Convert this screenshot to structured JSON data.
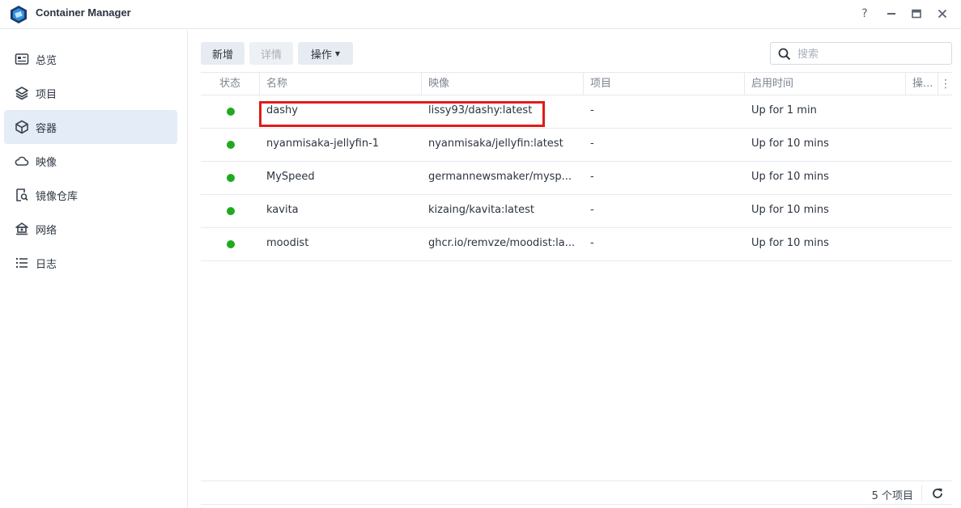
{
  "app": {
    "title": "Container Manager",
    "icon": "container-manager-logo",
    "window_controls": [
      "help-icon",
      "minimize-icon",
      "maximize-icon",
      "close-icon"
    ],
    "help_label": "?"
  },
  "sidebar": {
    "items": [
      {
        "label": "总览",
        "icon": "overview-icon",
        "active": false
      },
      {
        "label": "项目",
        "icon": "layers-icon",
        "active": false
      },
      {
        "label": "容器",
        "icon": "cube-icon",
        "active": true
      },
      {
        "label": "映像",
        "icon": "cloud-icon",
        "active": false
      },
      {
        "label": "镜像仓库",
        "icon": "registry-search-icon",
        "active": false
      },
      {
        "label": "网络",
        "icon": "network-icon",
        "active": false
      },
      {
        "label": "日志",
        "icon": "list-icon",
        "active": false
      }
    ]
  },
  "toolbar": {
    "new_label": "新增",
    "detail_label": "详情",
    "ops_label": "操作",
    "search_placeholder": "搜索"
  },
  "table": {
    "columns": [
      "状态",
      "名称",
      "映像",
      "项目",
      "启用时间",
      "操..."
    ],
    "rows": [
      {
        "status": "running",
        "name": "dashy",
        "image": "lissy93/dashy:latest",
        "project": "-",
        "uptime": "Up for 1 min"
      },
      {
        "status": "running",
        "name": "nyanmisaka-jellyfin-1",
        "image": "nyanmisaka/jellyfin:latest",
        "project": "-",
        "uptime": "Up for 10 mins"
      },
      {
        "status": "running",
        "name": "MySpeed",
        "image": "germannewsmaker/mysp...",
        "project": "-",
        "uptime": "Up for 10 mins"
      },
      {
        "status": "running",
        "name": "kavita",
        "image": "kizaing/kavita:latest",
        "project": "-",
        "uptime": "Up for 10 mins"
      },
      {
        "status": "running",
        "name": "moodist",
        "image": "ghcr.io/remvze/moodist:la...",
        "project": "-",
        "uptime": "Up for 10 mins"
      }
    ]
  },
  "footer": {
    "count_label": "5 个项目"
  },
  "colors": {
    "running": "#1faa1f",
    "active_bg": "#e3ecf7",
    "highlight": "#e11b1b"
  }
}
